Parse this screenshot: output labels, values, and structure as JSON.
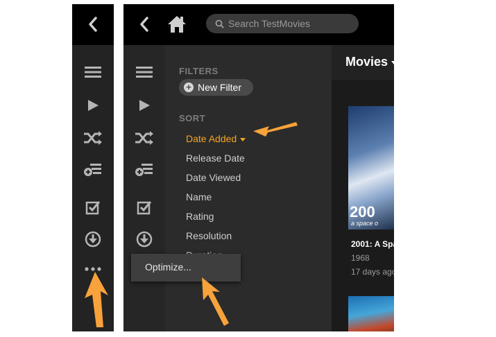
{
  "colors": {
    "accent": "#f5a623",
    "arrow": "#f7a23a"
  },
  "left_panel": {
    "icons": [
      "back-icon",
      "menu-icon",
      "play-icon",
      "shuffle-icon",
      "add-to-playlist-icon",
      "select-icon",
      "download-icon",
      "more-icon"
    ]
  },
  "main_panel": {
    "search": {
      "placeholder": "Search TestMovies"
    },
    "filters": {
      "filters_label": "FILTERS",
      "new_filter_label": "New Filter",
      "sort_label": "SORT",
      "sort_items": [
        {
          "label": "Date Added",
          "active": true
        },
        {
          "label": "Release Date"
        },
        {
          "label": "Date Viewed"
        },
        {
          "label": "Name"
        },
        {
          "label": "Rating"
        },
        {
          "label": "Resolution"
        },
        {
          "label": "Duration"
        }
      ]
    },
    "content": {
      "library_title": "Movies",
      "poster_text": "200",
      "poster_subtext": "a space o",
      "movie": {
        "title": "2001: A Spa",
        "year": "1968",
        "added": "17 days ago"
      }
    },
    "popup": {
      "label": "Optimize..."
    }
  }
}
